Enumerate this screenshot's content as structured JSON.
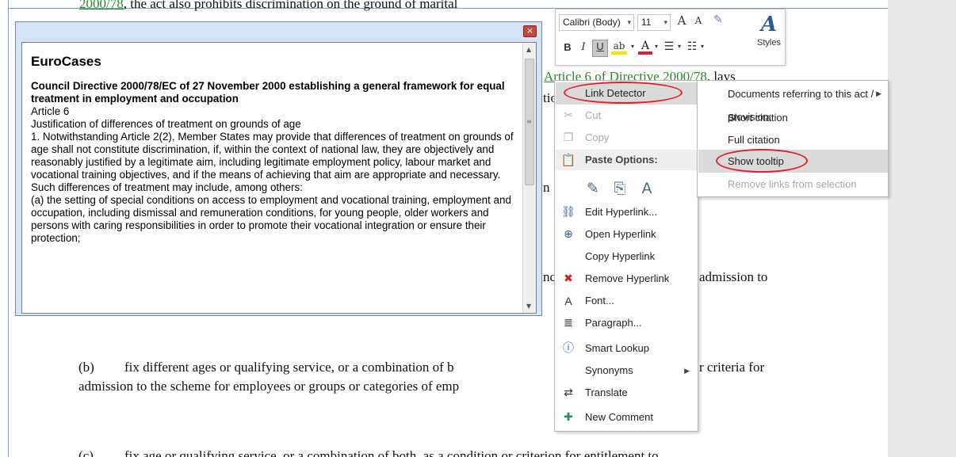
{
  "document": {
    "line_top": "2000/78, the act also prohibits discrimination on the ground of marital",
    "line_top_link": "2000/78",
    "line_top_rest": ", the act also prohibits discrimination on the ground of marital",
    "article_link": "Article 6 of Directive 2000/78",
    "article_rest": ", lays",
    "frag_tio": "tio",
    "frag_n": "n",
    "frag_nc": "nc",
    "frag_admission": "admission to",
    "para_b_label": "(b)",
    "para_b_line1": "fix different ages or qualifying service, or a combination of b",
    "para_b_line1_end": "r criteria for",
    "para_b_line2": "admission to the scheme for employees or groups or categories of emp",
    "para_c_label": "(c)",
    "para_c_line1": "fix age or qualifying service, or a combination of both, as a condition or criterion for entitlement to"
  },
  "tooltip": {
    "close_glyph": "×",
    "title": "EuroCases",
    "heading": "Council Directive 2000/78/EC of 27 November 2000 establishing a general framework for equal treatment in employment and occupation",
    "article": "Article 6",
    "subheading": "Justification of differences of treatment on grounds of age",
    "para1": "1. Notwithstanding Article 2(2), Member States may provide that differences of treatment on grounds of age shall not constitute discrimination, if, within the context of national law, they are objectively and reasonably justified by a legitimate aim, including legitimate employment policy, labour market and vocational training objectives, and if the means of achieving that aim are appropriate and necessary.",
    "para2": "Such differences of treatment may include, among others:",
    "para3": "(a) the setting of special conditions on access to employment and vocational training, employment and occupation, including dismissal and remuneration conditions, for young people, older workers and persons with caring responsibilities in order to promote their vocational integration or ensure their protection;"
  },
  "mini_toolbar": {
    "font_name": "Calibri (Body)",
    "font_size": "11",
    "grow_font": "A",
    "shrink_font": "A",
    "bold": "B",
    "italic": "I",
    "underline": "U",
    "highlight": "ab",
    "font_color": "A",
    "styles_label": "Styles",
    "styles_glyph": "A"
  },
  "context_menu": {
    "link_detector": "Link Detector",
    "cut": "Cut",
    "copy": "Copy",
    "paste_options": "Paste Options:",
    "edit_hyperlink": "Edit Hyperlink...",
    "open_hyperlink": "Open Hyperlink",
    "copy_hyperlink": "Copy Hyperlink",
    "remove_hyperlink": "Remove Hyperlink",
    "font": "Font...",
    "paragraph": "Paragraph...",
    "smart_lookup": "Smart Lookup",
    "synonyms": "Synonyms",
    "translate": "Translate",
    "new_comment": "New Comment"
  },
  "submenu": {
    "documents_referring": "Documents referring to this act / provision:",
    "short_citation": "Short citation",
    "full_citation": "Full citation",
    "show_tooltip": "Show tooltip",
    "remove_links": "Remove links from selection"
  },
  "icons": {
    "cut": "scissors-icon",
    "copy": "copy-icon",
    "paste": "clipboard-icon",
    "edit_hyperlink": "edit-link-icon",
    "open_hyperlink": "open-link-icon",
    "remove_hyperlink": "remove-link-icon",
    "font": "font-icon",
    "paragraph": "paragraph-icon",
    "smart_lookup": "smart-lookup-icon",
    "translate": "translate-icon",
    "new_comment": "comment-icon"
  },
  "colors": {
    "highlight_oval": "#e0202a",
    "link_green": "#2a8a2a",
    "menu_hover": "#dadada",
    "accent_blue": "#2b579a"
  }
}
